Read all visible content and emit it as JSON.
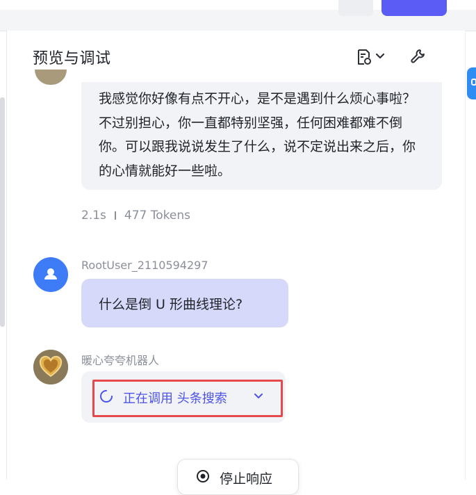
{
  "header": {
    "title": "预览与调试",
    "icons": [
      "document-settings-icon",
      "chevron-down-icon",
      "wrench-icon"
    ]
  },
  "conversation": {
    "bot_reply": {
      "text": "我感觉你好像有点不开心，是不是遇到什么烦心事啦？不过别担心，你一直都特别坚强，任何困难都难不倒你。可以跟我说说发生了什么，说不定说出来之后，你的心情就能好一些啦。",
      "duration": "2.1s",
      "tokens": "477 Tokens"
    },
    "user_message": {
      "username": "RootUser_2110594297",
      "text": "什么是倒 U 形曲线理论?"
    },
    "bot_pending": {
      "name": "暖心夸夸机器人",
      "status": "正在调用 头条搜索"
    }
  },
  "stop_button": {
    "label": "停止响应"
  },
  "colors": {
    "accent": "#5b5cf5",
    "user_bubble": "#d7d9fb",
    "bot_bubble": "#f2f3f6",
    "call_text": "#4d53e8",
    "highlight_border": "#e5484d",
    "user_avatar": "#3d7cf6"
  }
}
